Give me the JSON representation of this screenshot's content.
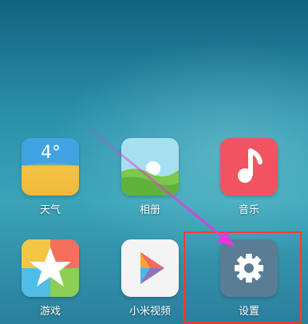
{
  "home_screen": {
    "apps": [
      {
        "label": "天气",
        "temperature": "4°",
        "icon": "weather-icon"
      },
      {
        "label": "相册",
        "icon": "gallery-icon"
      },
      {
        "label": "音乐",
        "icon": "music-note-icon"
      },
      {
        "label": "游戏",
        "icon": "star-icon"
      },
      {
        "label": "小米视频",
        "icon": "play-icon"
      },
      {
        "label": "设置",
        "icon": "gear-icon"
      }
    ]
  },
  "annotation": {
    "arrow_color": "#e23bd8",
    "highlight_color": "#ff3a2e"
  }
}
